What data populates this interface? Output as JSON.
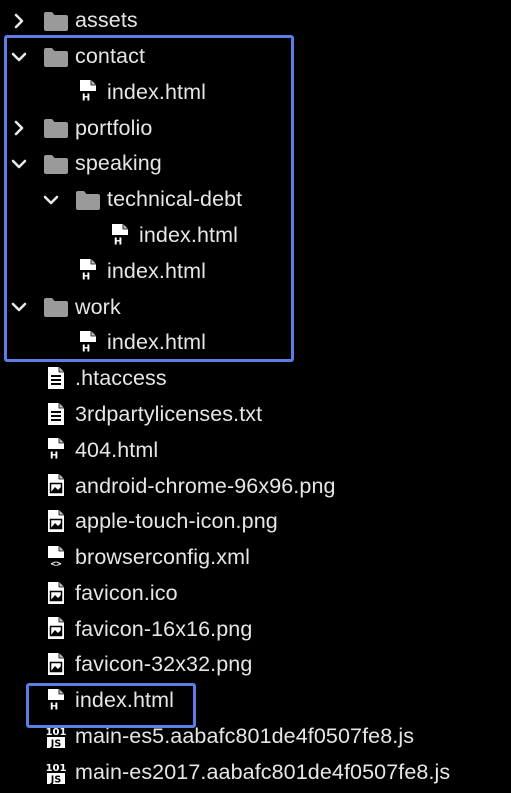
{
  "colors": {
    "background": "#000000",
    "text": "#e6e6e6",
    "folder": "#9a9a9a",
    "chevron": "#e8e8e8",
    "selection": "#5b7ee5"
  },
  "tree": [
    {
      "label": "assets",
      "depth": 0,
      "kind": "folder",
      "expanded": false,
      "icon": "folder-icon"
    },
    {
      "label": "contact",
      "depth": 0,
      "kind": "folder",
      "expanded": true,
      "icon": "folder-icon"
    },
    {
      "label": "index.html",
      "depth": 1,
      "kind": "file",
      "icon": "html-file-icon"
    },
    {
      "label": "portfolio",
      "depth": 0,
      "kind": "folder",
      "expanded": false,
      "icon": "folder-icon"
    },
    {
      "label": "speaking",
      "depth": 0,
      "kind": "folder",
      "expanded": true,
      "icon": "folder-icon"
    },
    {
      "label": "technical-debt",
      "depth": 1,
      "kind": "folder",
      "expanded": true,
      "icon": "folder-icon"
    },
    {
      "label": "index.html",
      "depth": 2,
      "kind": "file",
      "icon": "html-file-icon"
    },
    {
      "label": "index.html",
      "depth": 1,
      "kind": "file",
      "icon": "html-file-icon"
    },
    {
      "label": "work",
      "depth": 0,
      "kind": "folder",
      "expanded": true,
      "icon": "folder-icon"
    },
    {
      "label": "index.html",
      "depth": 1,
      "kind": "file",
      "icon": "html-file-icon"
    },
    {
      "label": ".htaccess",
      "depth": 0,
      "kind": "file",
      "icon": "text-file-icon"
    },
    {
      "label": "3rdpartylicenses.txt",
      "depth": 0,
      "kind": "file",
      "icon": "text-file-icon"
    },
    {
      "label": "404.html",
      "depth": 0,
      "kind": "file",
      "icon": "html-file-icon"
    },
    {
      "label": "android-chrome-96x96.png",
      "depth": 0,
      "kind": "file",
      "icon": "image-file-icon"
    },
    {
      "label": "apple-touch-icon.png",
      "depth": 0,
      "kind": "file",
      "icon": "image-file-icon"
    },
    {
      "label": "browserconfig.xml",
      "depth": 0,
      "kind": "file",
      "icon": "code-file-icon"
    },
    {
      "label": "favicon.ico",
      "depth": 0,
      "kind": "file",
      "icon": "image-file-icon"
    },
    {
      "label": "favicon-16x16.png",
      "depth": 0,
      "kind": "file",
      "icon": "image-file-icon"
    },
    {
      "label": "favicon-32x32.png",
      "depth": 0,
      "kind": "file",
      "icon": "image-file-icon"
    },
    {
      "label": "index.html",
      "depth": 0,
      "kind": "file",
      "icon": "html-file-icon"
    },
    {
      "label": "main-es5.aabafc801de4f0507fe8.js",
      "depth": 0,
      "kind": "file",
      "icon": "js-file-icon"
    },
    {
      "label": "main-es2017.aabafc801de4f0507fe8.js",
      "depth": 0,
      "kind": "file",
      "icon": "js-file-icon"
    }
  ],
  "icon_glyphs": {
    "html": "H",
    "js_top": "101",
    "js_bottom": "JS",
    "code": "<>"
  }
}
